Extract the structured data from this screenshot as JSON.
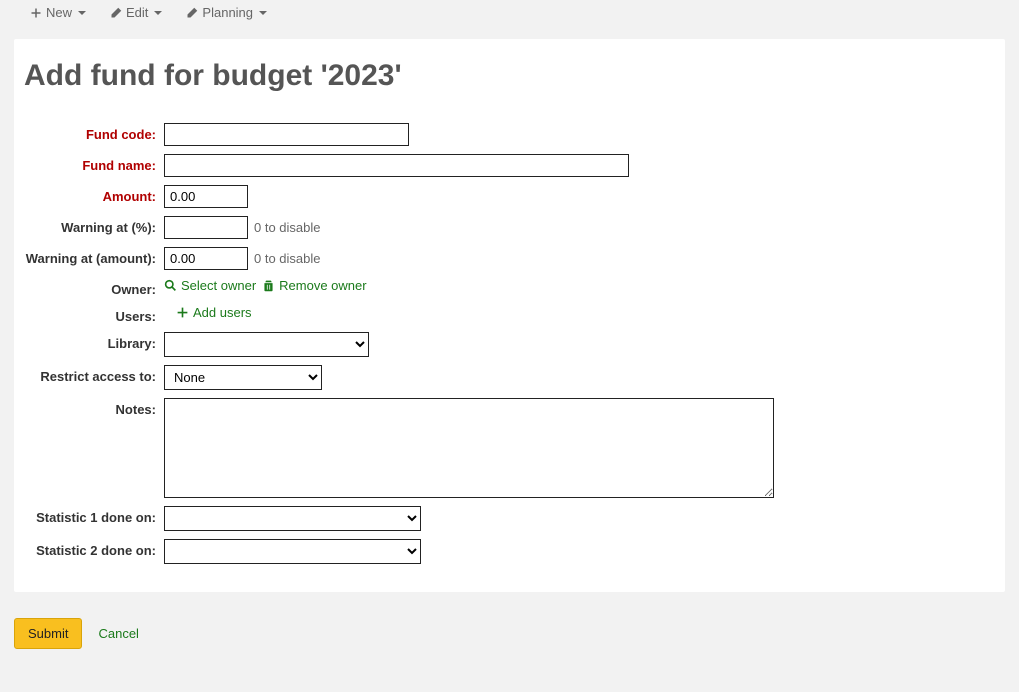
{
  "toolbar": {
    "new_label": "New",
    "edit_label": "Edit",
    "planning_label": "Planning"
  },
  "page_title": "Add fund for budget '2023'",
  "form": {
    "fund_code": {
      "label": "Fund code:",
      "value": ""
    },
    "fund_name": {
      "label": "Fund name:",
      "value": ""
    },
    "amount": {
      "label": "Amount:",
      "value": "0.00"
    },
    "warning_pct": {
      "label": "Warning at (%):",
      "value": "",
      "hint": "0 to disable"
    },
    "warning_amt": {
      "label": "Warning at (amount):",
      "value": "0.00",
      "hint": "0 to disable"
    },
    "owner": {
      "label": "Owner:",
      "select_owner": "Select owner",
      "remove_owner": "Remove owner"
    },
    "users": {
      "label": "Users:",
      "add_users": "Add users"
    },
    "library": {
      "label": "Library:",
      "value": ""
    },
    "restrict": {
      "label": "Restrict access to:",
      "value": "None"
    },
    "notes": {
      "label": "Notes:",
      "value": ""
    },
    "stat1": {
      "label": "Statistic 1 done on:",
      "value": ""
    },
    "stat2": {
      "label": "Statistic 2 done on:",
      "value": ""
    }
  },
  "actions": {
    "submit": "Submit",
    "cancel": "Cancel"
  }
}
